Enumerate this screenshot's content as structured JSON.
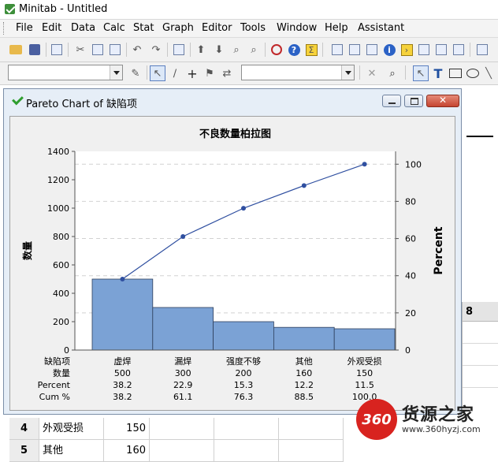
{
  "window": {
    "title": "Minitab - Untitled"
  },
  "menu": [
    "File",
    "Edit",
    "Data",
    "Calc",
    "Stat",
    "Graph",
    "Editor",
    "Tools",
    "Window",
    "Help",
    "Assistant"
  ],
  "chart_window": {
    "title": "Pareto Chart of 缺陷项"
  },
  "chart_data": {
    "type": "bar",
    "title": "不良数量柏拉图",
    "ylabel": "数量",
    "y2label": "Percent",
    "categories": [
      "虚焊",
      "漏焊",
      "强度不够",
      "其他",
      "外观受损"
    ],
    "series": [
      {
        "name": "数量",
        "values": [
          500,
          300,
          200,
          160,
          150
        ]
      },
      {
        "name": "Cum %",
        "values": [
          38.2,
          61.1,
          76.3,
          88.5,
          100.0
        ]
      }
    ],
    "ylim": [
      0,
      1400
    ],
    "yticks": [
      0,
      200,
      400,
      600,
      800,
      1000,
      1200,
      1400
    ],
    "y2lim": [
      0,
      106.9
    ],
    "y2ticks": [
      0,
      20,
      40,
      60,
      80,
      100
    ],
    "grid": true,
    "table": {
      "row_labels": [
        "缺陷项",
        "数量",
        "Percent",
        "Cum %"
      ],
      "counts": [
        "500",
        "300",
        "200",
        "160",
        "150"
      ],
      "percent": [
        "38.2",
        "22.9",
        "15.3",
        "12.2",
        "11.5"
      ],
      "cum": [
        "38.2",
        "61.1",
        "76.3",
        "88.5",
        "100.0"
      ]
    }
  },
  "background": {
    "column_header": "8"
  },
  "worksheet_rows": [
    {
      "num": "4",
      "name": "外观受损",
      "value": "150"
    },
    {
      "num": "5",
      "name": "其他",
      "value": "160"
    }
  ],
  "watermark": {
    "logo": "360",
    "name": "货源之家",
    "url": "www.360hyzj.com"
  }
}
